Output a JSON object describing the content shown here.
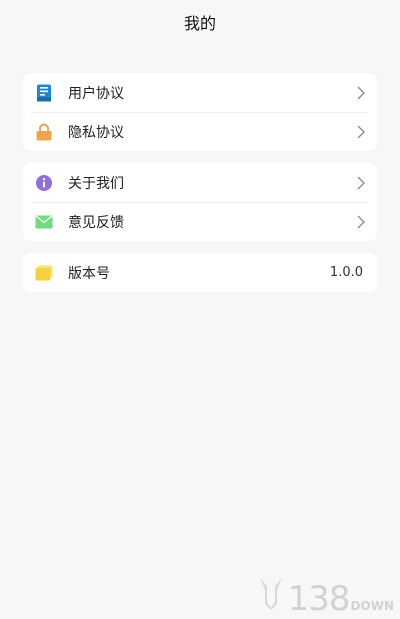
{
  "header": {
    "title": "我的"
  },
  "groups": [
    {
      "items": [
        {
          "label": "用户协议",
          "icon": "document-icon",
          "color": "#1e88d8"
        },
        {
          "label": "隐私协议",
          "icon": "lock-icon",
          "color": "#f2a34a"
        }
      ]
    },
    {
      "items": [
        {
          "label": "关于我们",
          "icon": "info-icon",
          "color": "#8e6fe0"
        },
        {
          "label": "意见反馈",
          "icon": "mail-icon",
          "color": "#6fdc7f"
        }
      ]
    },
    {
      "items": [
        {
          "label": "版本号",
          "icon": "folder-icon",
          "color": "#f4d23c",
          "value": "1.0.0"
        }
      ]
    }
  ],
  "watermark": {
    "number": "138",
    "suffix": "DOWN"
  }
}
